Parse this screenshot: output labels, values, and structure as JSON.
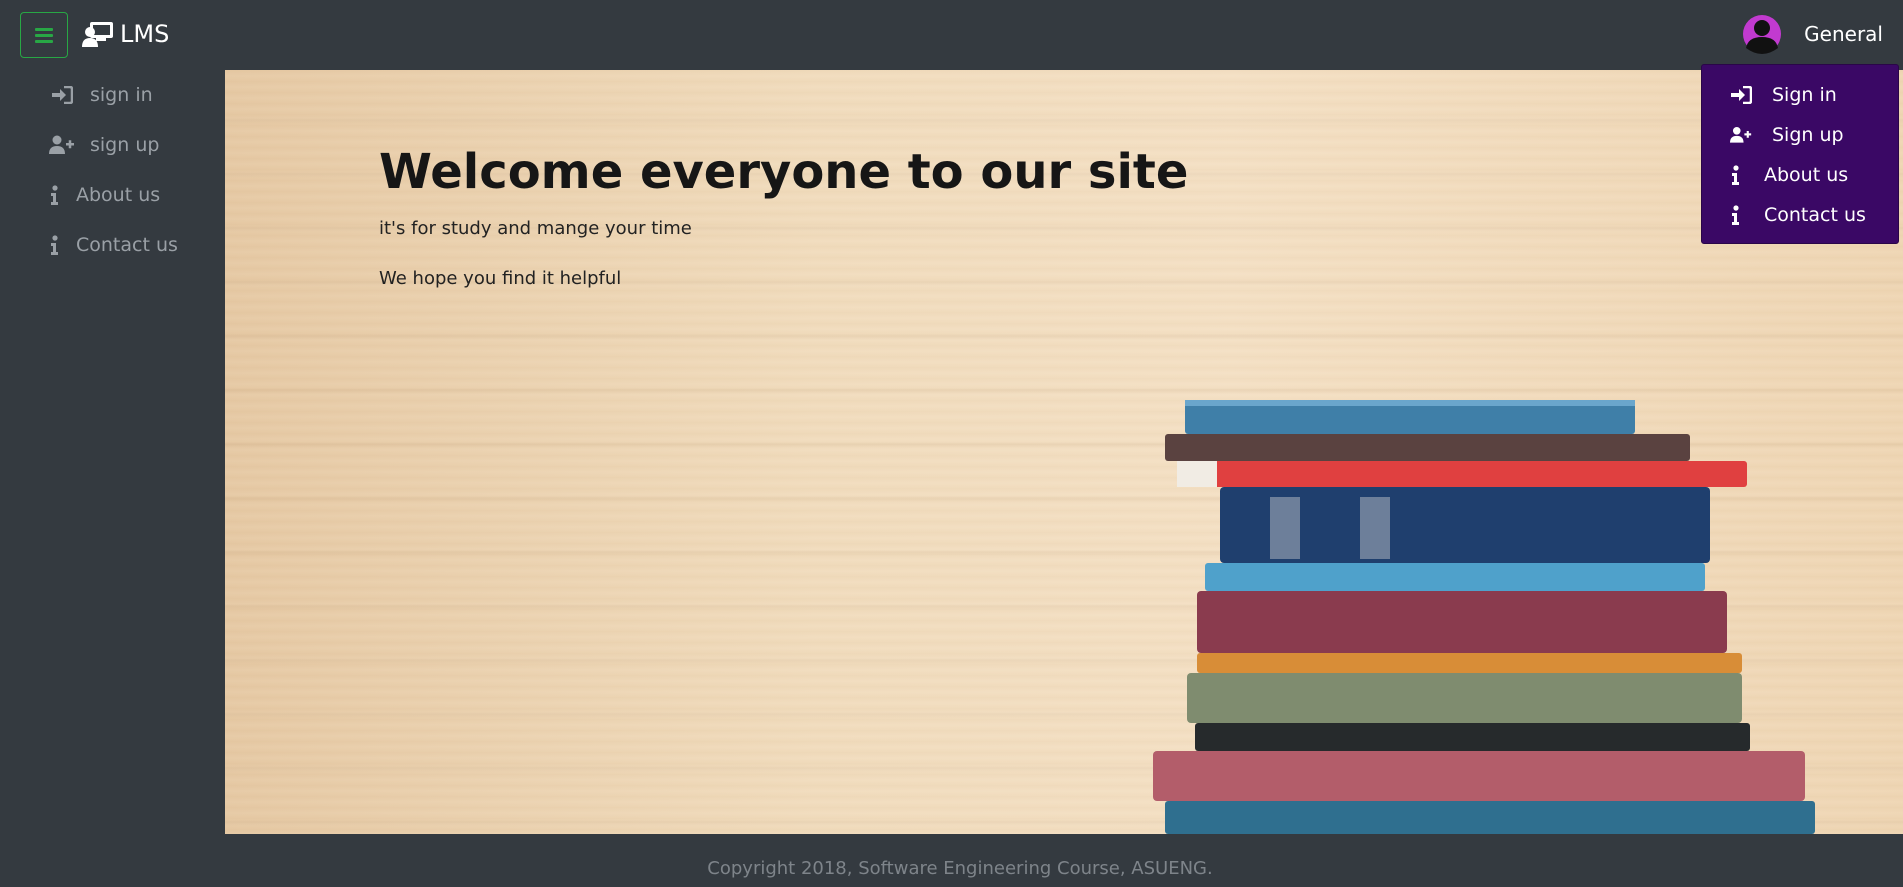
{
  "brand": {
    "name": "LMS",
    "icon": "chalkboard-teacher-icon"
  },
  "user": {
    "name": "General",
    "avatar": "user-avatar-icon"
  },
  "sidebar": {
    "items": [
      {
        "label": "sign in",
        "icon": "sign-in-icon"
      },
      {
        "label": "sign up",
        "icon": "user-plus-icon"
      },
      {
        "label": "About us",
        "icon": "info-icon"
      },
      {
        "label": "Contact us",
        "icon": "info-icon"
      }
    ]
  },
  "dropdown": {
    "items": [
      {
        "label": "Sign in",
        "icon": "sign-in-icon"
      },
      {
        "label": "Sign up",
        "icon": "user-plus-icon"
      },
      {
        "label": "About us",
        "icon": "info-icon"
      },
      {
        "label": "Contact us",
        "icon": "info-icon"
      }
    ]
  },
  "hero": {
    "title": "Welcome everyone to our site",
    "subtitle": "it's for study and mange your time",
    "message": "We hope you find it helpful"
  },
  "footer": {
    "text": "Copyright 2018, Software Engineering Course, ASUENG."
  },
  "colors": {
    "navbar": "#343a40",
    "toggle_border": "#28a745",
    "dropdown_bg": "#3a0865",
    "avatar_ring": "#c23ad0"
  }
}
